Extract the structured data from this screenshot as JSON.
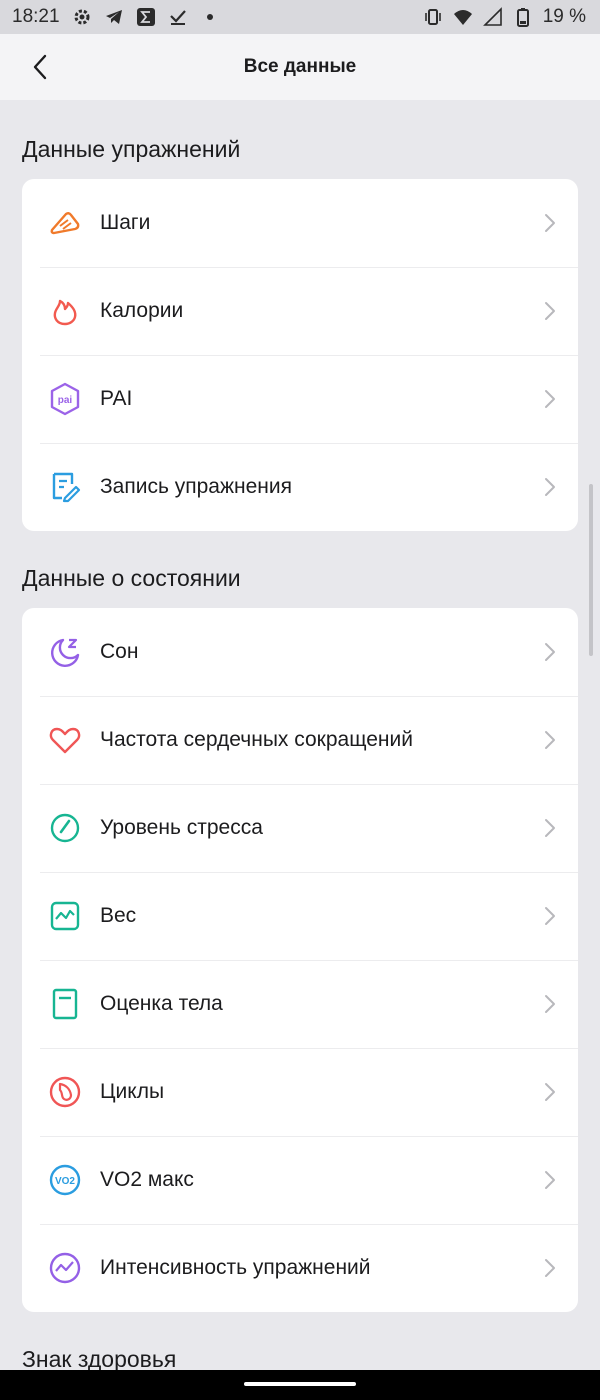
{
  "status_bar": {
    "time": "18:21",
    "battery": "19 %",
    "icons": [
      "settings-icon",
      "telegram-icon",
      "sigma-icon",
      "check-icon",
      "dot-icon",
      "vibrate-icon",
      "wifi-icon",
      "signal-icon",
      "battery-icon"
    ]
  },
  "header": {
    "title": "Все данные",
    "back_icon": "chevron-left-icon"
  },
  "sections": [
    {
      "title": "Данные упражнений",
      "items": [
        {
          "label": "Шаги",
          "icon": "shoe-icon",
          "color": "#f07a2b"
        },
        {
          "label": "Калории",
          "icon": "flame-icon",
          "color": "#f25a4f"
        },
        {
          "label": "PAI",
          "icon": "pai-icon",
          "color": "#9b63e8"
        },
        {
          "label": "Запись упражнения",
          "icon": "workout-record-icon",
          "color": "#2b9de0"
        }
      ]
    },
    {
      "title": "Данные о состоянии",
      "items": [
        {
          "label": "Сон",
          "icon": "moon-icon",
          "color": "#9460e6"
        },
        {
          "label": "Частота сердечных сокращений",
          "icon": "heart-icon",
          "color": "#f05656"
        },
        {
          "label": "Уровень стресса",
          "icon": "gauge-icon",
          "color": "#17b592"
        },
        {
          "label": "Вес",
          "icon": "weight-chart-icon",
          "color": "#17b592"
        },
        {
          "label": "Оценка тела",
          "icon": "body-report-icon",
          "color": "#17b592"
        },
        {
          "label": "Циклы",
          "icon": "cycle-icon",
          "color": "#f05656"
        },
        {
          "label": "VO2 макс",
          "icon": "vo2-icon",
          "color": "#2b9de0"
        },
        {
          "label": "Интенсивность упражнений",
          "icon": "intensity-icon",
          "color": "#9460e6"
        }
      ]
    },
    {
      "title": "Знак здоровья",
      "items": []
    }
  ]
}
